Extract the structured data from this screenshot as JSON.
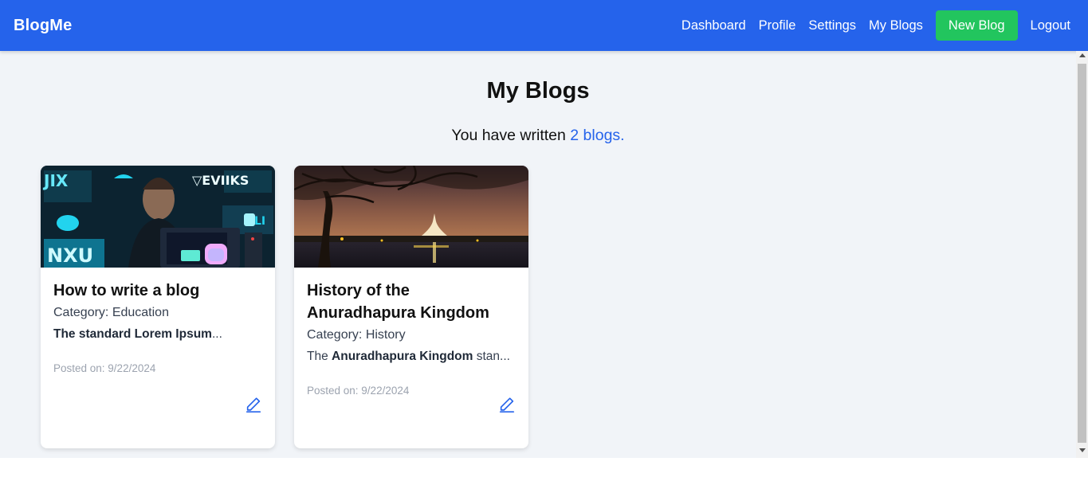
{
  "navbar": {
    "brand": "BlogMe",
    "links": {
      "dashboard": "Dashboard",
      "profile": "Profile",
      "settings": "Settings",
      "my_blogs": "My Blogs",
      "new_blog": "New Blog",
      "logout": "Logout"
    },
    "color": "#2563eb",
    "new_blog_color": "#22c55e"
  },
  "main": {
    "title": "My Blogs",
    "summary_prefix": "You have written",
    "summary_count": "2 blogs."
  },
  "blogs": [
    {
      "title": "How to write a blog",
      "category": "Category: Education",
      "excerpt_bold": "The standard Lorem Ipsum",
      "excerpt_rest": "...",
      "posted": "Posted on: 9/22/2024",
      "image": "tech-workspace-photo",
      "edit_icon": "pencil-icon"
    },
    {
      "title": "History of the Anuradhapura Kingdom",
      "category": "Category: History",
      "excerpt_pre": "The",
      "excerpt_bold": "Anuradhapura Kingdom",
      "excerpt_rest": "stan...",
      "posted": "Posted on: 9/22/2024",
      "image": "stupa-lake-night-photo",
      "edit_icon": "pencil-icon"
    }
  ]
}
